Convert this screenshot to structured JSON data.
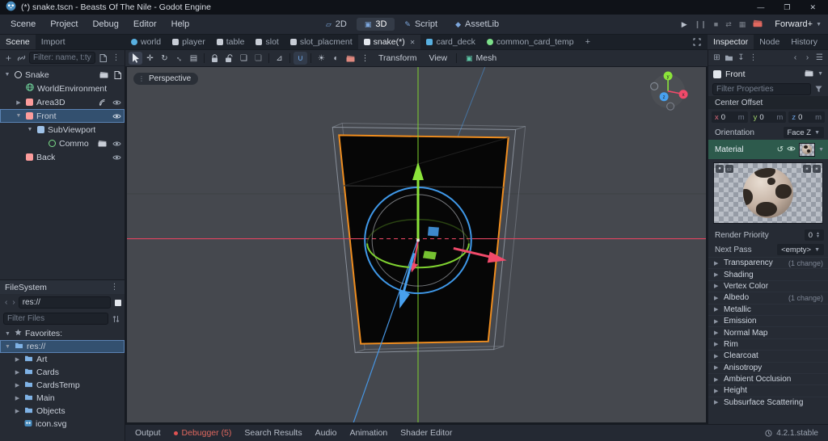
{
  "window": {
    "title": "(*) snake.tscn - Beasts Of The Nile - Godot Engine"
  },
  "menubar": {
    "menus": [
      "Scene",
      "Project",
      "Debug",
      "Editor",
      "Help"
    ],
    "workspaces": [
      "2D",
      "3D",
      "Script",
      "AssetLib"
    ],
    "active_workspace": "3D",
    "renderer": "Forward+"
  },
  "scene_tabs": {
    "tabs": [
      {
        "label": "world"
      },
      {
        "label": "player"
      },
      {
        "label": "table"
      },
      {
        "label": "slot"
      },
      {
        "label": "slot_placment"
      },
      {
        "label": "snake(*)",
        "active": true,
        "closable": true
      },
      {
        "label": "card_deck"
      },
      {
        "label": "common_card_temp"
      }
    ]
  },
  "left_dock": {
    "tabs": [
      "Scene",
      "Import"
    ],
    "active_tab": "Scene",
    "filter_placeholder": "Filter: name, t:ty",
    "tree": [
      {
        "label": "Snake",
        "depth": 0
      },
      {
        "label": "WorldEnvironment",
        "depth": 1
      },
      {
        "label": "Area3D",
        "depth": 1
      },
      {
        "label": "Front",
        "depth": 1,
        "selected": true
      },
      {
        "label": "SubViewport",
        "depth": 2
      },
      {
        "label": "CommonCardTemp",
        "depth": 3
      },
      {
        "label": "Back",
        "depth": 1
      }
    ]
  },
  "filesystem": {
    "title": "FileSystem",
    "path": "res://",
    "filter_placeholder": "Filter Files",
    "items": [
      {
        "label": "Favorites:",
        "type": "favorites"
      },
      {
        "label": "res://",
        "type": "folder",
        "selected": true
      },
      {
        "label": "Art",
        "type": "folder"
      },
      {
        "label": "Cards",
        "type": "folder"
      },
      {
        "label": "CardsTemp",
        "type": "folder"
      },
      {
        "label": "Main",
        "type": "folder"
      },
      {
        "label": "Objects",
        "type": "folder"
      },
      {
        "label": "icon.svg",
        "type": "file"
      }
    ]
  },
  "viewport": {
    "perspective_label": "Perspective",
    "menus": [
      "Transform",
      "View"
    ],
    "mesh_menu": "Mesh"
  },
  "inspector": {
    "tabs": [
      "Inspector",
      "Node",
      "History"
    ],
    "active_tab": "Inspector",
    "node_name": "Front",
    "filter_placeholder": "Filter Properties",
    "properties": {
      "center_offset_label": "Center Offset",
      "vector3": [
        {
          "axis": "x",
          "value": "0",
          "unit": "m"
        },
        {
          "axis": "y",
          "value": "0",
          "unit": "m"
        },
        {
          "axis": "z",
          "value": "0",
          "unit": "m"
        }
      ],
      "orientation_label": "Orientation",
      "orientation_value": "Face Z",
      "material_label": "Material",
      "render_priority_label": "Render Priority",
      "render_priority_value": "0",
      "next_pass_label": "Next Pass",
      "next_pass_value": "<empty>"
    },
    "sections": [
      {
        "label": "Transparency",
        "note": "(1 change)"
      },
      {
        "label": "Shading",
        "note": ""
      },
      {
        "label": "Vertex Color",
        "note": ""
      },
      {
        "label": "Albedo",
        "note": "(1 change)"
      },
      {
        "label": "Metallic",
        "note": ""
      },
      {
        "label": "Emission",
        "note": ""
      },
      {
        "label": "Normal Map",
        "note": ""
      },
      {
        "label": "Rim",
        "note": ""
      },
      {
        "label": "Clearcoat",
        "note": ""
      },
      {
        "label": "Anisotropy",
        "note": ""
      },
      {
        "label": "Ambient Occlusion",
        "note": ""
      },
      {
        "label": "Height",
        "note": ""
      },
      {
        "label": "Subsurface Scattering",
        "note": ""
      }
    ]
  },
  "bottom_bar": {
    "items": [
      {
        "label": "Output"
      },
      {
        "label": "Debugger (5)",
        "alert": true
      },
      {
        "label": "Search Results"
      },
      {
        "label": "Audio"
      },
      {
        "label": "Animation"
      },
      {
        "label": "Shader Editor"
      }
    ],
    "version": "4.2.1.stable"
  },
  "icons": {
    "search": "magnifier",
    "visibility": "eye",
    "folder": "blue-folder",
    "favorites": "star",
    "snap": "magnet",
    "mesh_menu_icon": "teal-cube",
    "debugger_alert": "red-dot",
    "app": "godot-logo"
  },
  "colors": {
    "accent": "#699ce8",
    "selection_outline": "#ef8d1f",
    "axis_x": "#e0435f",
    "axis_y": "#7fd130",
    "axis_z": "#4695e2",
    "material_row": "#2d5a4c"
  }
}
